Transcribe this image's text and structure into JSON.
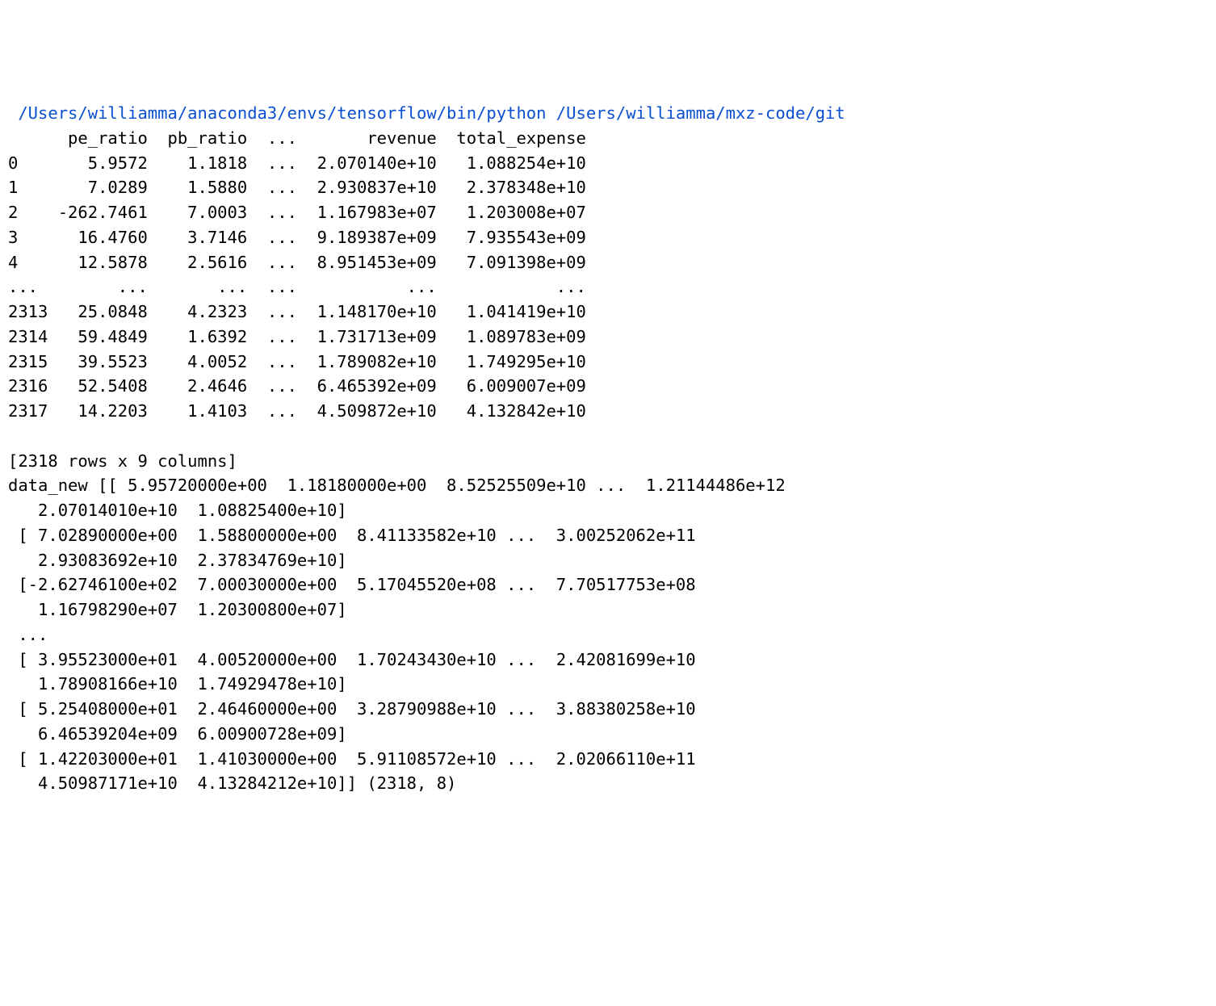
{
  "command": " /Users/williamma/anaconda3/envs/tensorflow/bin/python /Users/williamma/mxz-code/git",
  "df_header": "      pe_ratio  pb_ratio  ...       revenue  total_expense",
  "df_rows": [
    "0       5.9572    1.1818  ...  2.070140e+10   1.088254e+10",
    "1       7.0289    1.5880  ...  2.930837e+10   2.378348e+10",
    "2    -262.7461    7.0003  ...  1.167983e+07   1.203008e+07",
    "3      16.4760    3.7146  ...  9.189387e+09   7.935543e+09",
    "4      12.5878    2.5616  ...  8.951453e+09   7.091398e+09",
    "...        ...       ...  ...           ...            ...",
    "2313   25.0848    4.2323  ...  1.148170e+10   1.041419e+10",
    "2314   59.4849    1.6392  ...  1.731713e+09   1.089783e+09",
    "2315   39.5523    4.0052  ...  1.789082e+10   1.749295e+10",
    "2316   52.5408    2.4646  ...  6.465392e+09   6.009007e+09",
    "2317   14.2203    1.4103  ...  4.509872e+10   4.132842e+10"
  ],
  "df_shape": "[2318 rows x 9 columns]",
  "array_output": [
    "data_new [[ 5.95720000e+00  1.18180000e+00  8.52525509e+10 ...  1.21144486e+12",
    "   2.07014010e+10  1.08825400e+10]",
    " [ 7.02890000e+00  1.58800000e+00  8.41133582e+10 ...  3.00252062e+11",
    "   2.93083692e+10  2.37834769e+10]",
    " [-2.62746100e+02  7.00030000e+00  5.17045520e+08 ...  7.70517753e+08",
    "   1.16798290e+07  1.20300800e+07]",
    " ...",
    " [ 3.95523000e+01  4.00520000e+00  1.70243430e+10 ...  2.42081699e+10",
    "   1.78908166e+10  1.74929478e+10]",
    " [ 5.25408000e+01  2.46460000e+00  3.28790988e+10 ...  3.88380258e+10",
    "   6.46539204e+09  6.00900728e+09]",
    " [ 1.42203000e+01  1.41030000e+00  5.91108572e+10 ...  2.02066110e+11",
    "   4.50987171e+10  4.13284212e+10]] (2318, 8)"
  ]
}
